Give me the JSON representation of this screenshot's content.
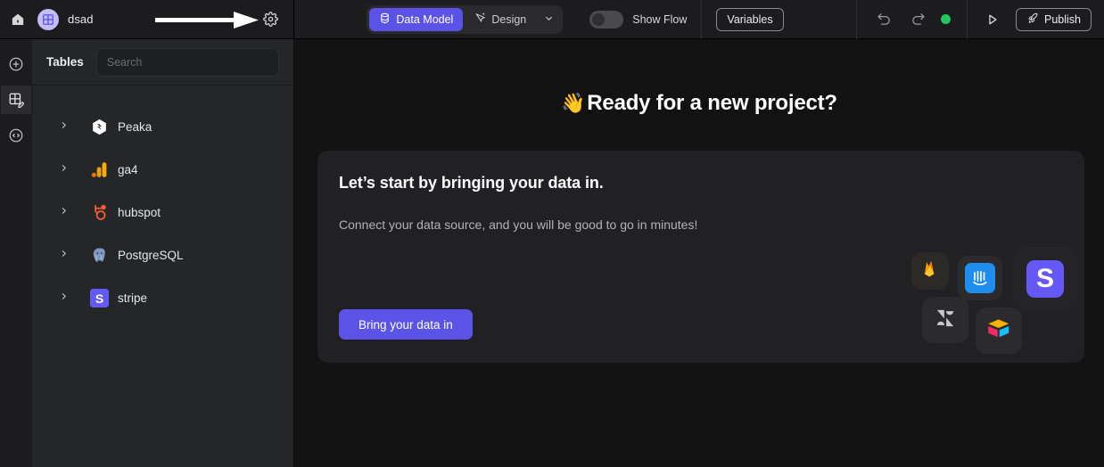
{
  "topbar": {
    "home_icon": "home-icon",
    "project_avatar_icon": "grid-table-icon",
    "project_name": "dsad",
    "gear_icon": "gear-icon",
    "annotation_arrow": "right-arrow-annotation",
    "segments": [
      {
        "label": "Data Model",
        "icon": "database-icon",
        "active": true
      },
      {
        "label": "Design",
        "icon": "cursor-design-icon",
        "active": false
      },
      {
        "label": "",
        "icon": "chevron-down-icon",
        "active": false
      }
    ],
    "toggle": {
      "label": "Show Flow",
      "state": "off"
    },
    "variables_label": "Variables",
    "undo_icon": "undo-icon",
    "redo_icon": "redo-icon",
    "status_dot_color": "#22c55e",
    "run_icon": "play-icon",
    "publish_label": "Publish",
    "publish_icon": "rocket-icon"
  },
  "rail": {
    "items": [
      {
        "name": "add-icon",
        "active": false
      },
      {
        "name": "table-edit-icon",
        "active": true
      },
      {
        "name": "code-icon",
        "active": false
      }
    ]
  },
  "sidebar": {
    "title": "Tables",
    "search": {
      "value": "",
      "placeholder": "Search"
    },
    "sources": [
      {
        "label": "Peaka",
        "icon": "peaka-logo-icon"
      },
      {
        "label": "ga4",
        "icon": "google-analytics-logo-icon"
      },
      {
        "label": "hubspot",
        "icon": "hubspot-logo-icon"
      },
      {
        "label": "PostgreSQL",
        "icon": "postgresql-logo-icon"
      },
      {
        "label": "stripe",
        "icon": "stripe-logo-icon"
      }
    ],
    "expand_icon": "chevron-right-icon"
  },
  "canvas": {
    "hero_emoji": "👋",
    "hero_title": "Ready for a new project?",
    "card": {
      "heading": "Let’s start by bringing your data in.",
      "subheading": "Connect your data source, and you will be good to go in minutes!",
      "cta_label": "Bring your data in",
      "cta_color": "#5b53e8",
      "logos": [
        {
          "name": "firebase-logo-icon"
        },
        {
          "name": "intercom-logo-icon"
        },
        {
          "name": "zendesk-logo-icon"
        },
        {
          "name": "airtable-logo-icon"
        },
        {
          "name": "stripe-logo-icon"
        }
      ]
    }
  }
}
